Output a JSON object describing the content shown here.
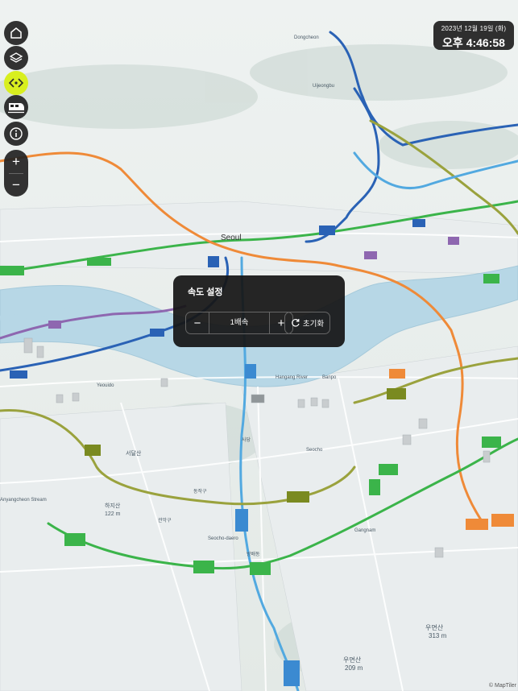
{
  "map": {
    "labels": {
      "seoul": "Seoul",
      "hangang": "Hangang River",
      "anyangcheon": "Anyangcheon Stream",
      "seodalsan": "서달산",
      "hajisan": "하지산",
      "hajisan_elev": "122 m",
      "umyeonsan": "우면산",
      "umyeonsan_elev": "313 m",
      "umyeonsan2": "우면산",
      "umyeonsan2_elev": "209 m",
      "dobong": "Dongcheon",
      "uijeongbu": "Uijeongbu",
      "gwanak": "관악구",
      "dongjak": "동작구",
      "seocho": "Seocho",
      "gangnam": "Gangnam",
      "sadang": "사당",
      "bangbae": "방배동",
      "seocho_road": "Seocho-daero",
      "banpo": "Banpo",
      "yeouido": "Yeouido"
    },
    "attribution": "© MapTiler"
  },
  "controls": {
    "home": "home-icon",
    "layers": "layers-icon",
    "animation": "arrows-icon",
    "train": "train-icon",
    "info": "info-icon",
    "zoom_in": "+",
    "zoom_out": "−",
    "animation_color": "#d8ef1f"
  },
  "clock": {
    "date": "2023년 12월 19일 (화)",
    "time": "오후 4:46:58"
  },
  "speed_panel": {
    "title": "속도 설정",
    "minus": "−",
    "value": "1배속",
    "plus": "+",
    "reset": "초기화"
  }
}
